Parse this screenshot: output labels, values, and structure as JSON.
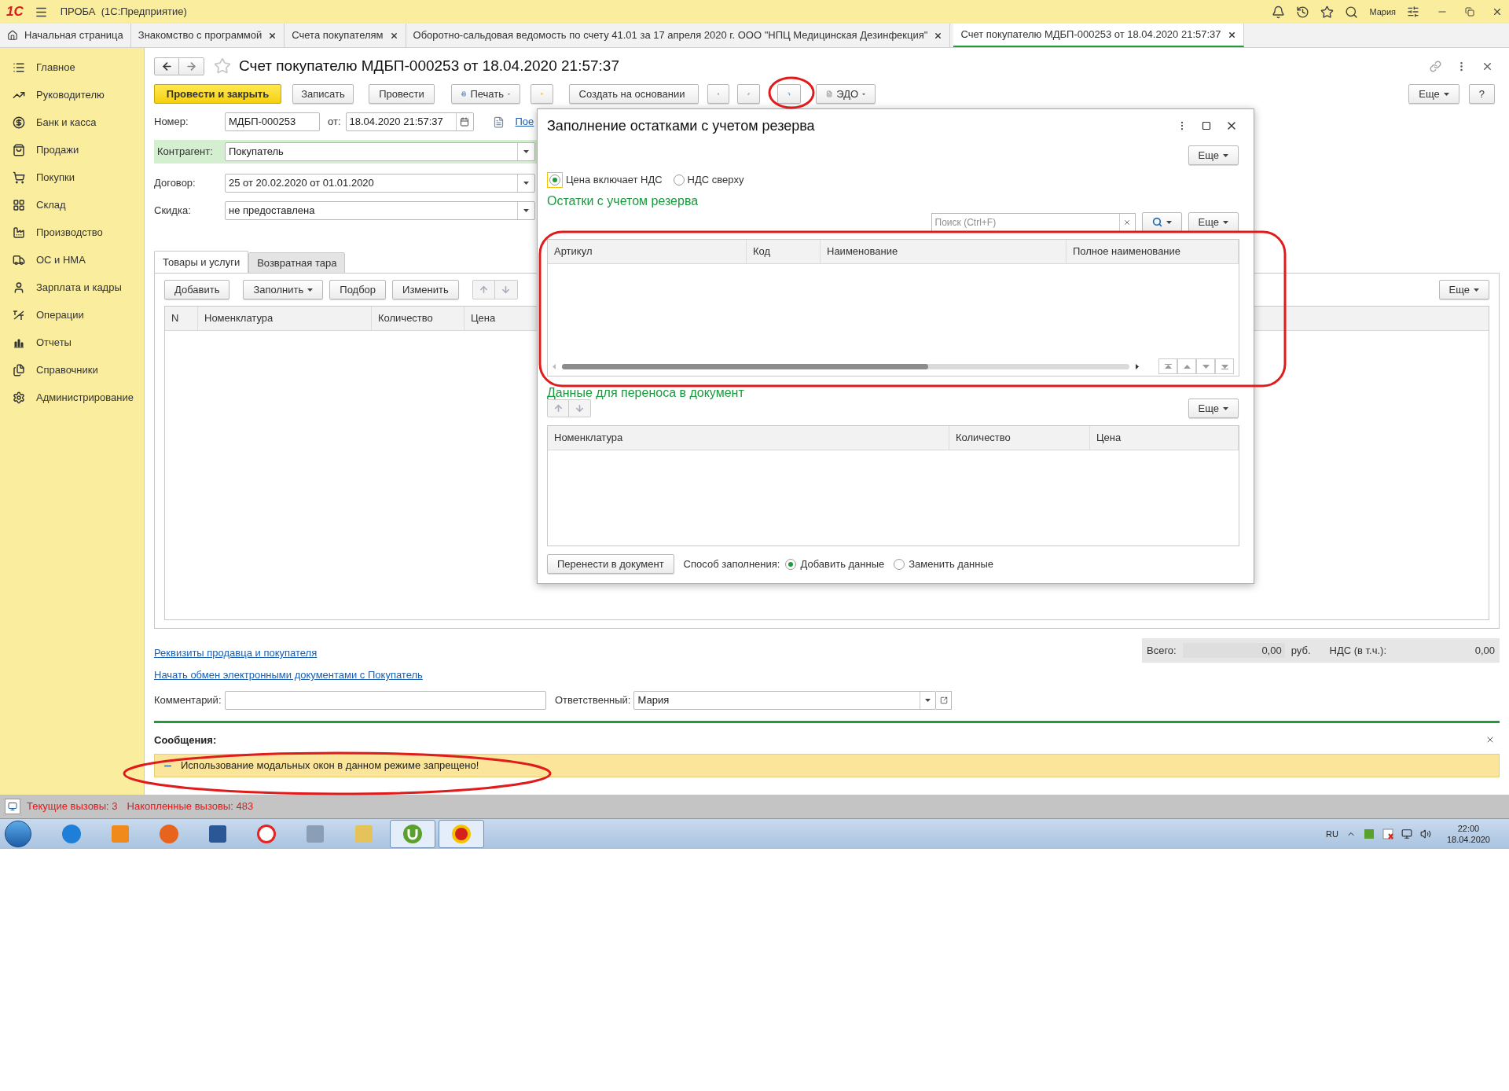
{
  "title_bar": {
    "logo": "1С",
    "app_title": "ПРОБА  (1С:Предприятие)",
    "user": "Мария"
  },
  "tabs": [
    {
      "label": "Начальная страница",
      "kind": "home",
      "selected": false
    },
    {
      "label": "Знакомство с программой",
      "kind": "page",
      "selected": false
    },
    {
      "label": "Счета покупателям",
      "kind": "page",
      "selected": false
    },
    {
      "label": "Оборотно-сальдовая ведомость по счету 41.01 за 17 апреля 2020 г. ООО \"НПЦ Медицинская Дезинфекция\"",
      "kind": "page",
      "selected": false
    },
    {
      "label": "Счет покупателю МДБП-000253 от 18.04.2020 21:57:37",
      "kind": "page",
      "selected": true
    }
  ],
  "sidebar": {
    "items": [
      {
        "label": "Главное",
        "kind": "menu"
      },
      {
        "label": "Руководителю",
        "kind": "trend"
      },
      {
        "label": "Банк и касса",
        "kind": "ruble"
      },
      {
        "label": "Продажи",
        "kind": "bag"
      },
      {
        "label": "Покупки",
        "kind": "cart"
      },
      {
        "label": "Склад",
        "kind": "grid"
      },
      {
        "label": "Производство",
        "kind": "factory"
      },
      {
        "label": "ОС и НМА",
        "kind": "truck"
      },
      {
        "label": "Зарплата и кадры",
        "kind": "user"
      },
      {
        "label": "Операции",
        "kind": "ledger"
      },
      {
        "label": "Отчеты",
        "kind": "chart"
      },
      {
        "label": "Справочники",
        "kind": "books"
      },
      {
        "label": "Администрирование",
        "kind": "gear"
      }
    ]
  },
  "document": {
    "title": "Счет покупателю МДБП-000253 от 18.04.2020 21:57:37",
    "favorite": false,
    "toolbar": [
      {
        "label": "Провести и закрыть",
        "kind": "primary"
      },
      {
        "label": "Записать",
        "kind": "button"
      },
      {
        "label": "Провести",
        "kind": "button"
      },
      {
        "label": "Печать",
        "kind": "menu"
      },
      {
        "kind": "icon"
      },
      {
        "label": "Создать на основании",
        "kind": "menu"
      },
      {
        "kind": "icon"
      },
      {
        "kind": "icon"
      },
      {
        "kind": "icon"
      },
      {
        "label": "ЭДО",
        "kind": "menu"
      }
    ],
    "more": "Еще",
    "help": "?",
    "number_label": "Номер:",
    "number": "МДБП-000253",
    "date_label": "от:",
    "date": "18.04.2020 21:57:37",
    "link_cut": "Пое",
    "fields": [
      {
        "label": "Контрагент:",
        "value": "Покупатель",
        "highlighted": true
      },
      {
        "label": "Договор:",
        "value": "25 от 20.02.2020 от 01.01.2020",
        "highlighted": false
      },
      {
        "label": "Скидка:",
        "value": "не предоставлена",
        "highlighted": false
      }
    ],
    "section_tabs": [
      {
        "label": "Товары и услуги",
        "selected": true
      },
      {
        "label": "Возвратная тара",
        "selected": false
      }
    ],
    "table_buttons": [
      {
        "label": "Добавить",
        "kind": "button"
      },
      {
        "label": "Заполнить",
        "kind": "menu"
      },
      {
        "label": "Подбор",
        "kind": "button"
      },
      {
        "label": "Изменить",
        "kind": "button"
      }
    ],
    "table_more": "Еще",
    "table": {
      "columns": [
        "N",
        "Номенклатура",
        "Количество",
        "Цена"
      ]
    },
    "links": [
      "Реквизиты продавца и покупателя",
      "Начать обмен электронными документами с Покупатель"
    ],
    "totals": {
      "total_label": "Всего:",
      "total": "0,00",
      "currency": "руб.",
      "vat_label": "НДС (в т.ч.):",
      "vat": "0,00"
    },
    "comment_label": "Комментарий:",
    "responsible_label": "Ответственный:",
    "responsible": "Мария"
  },
  "messages": {
    "title": "Сообщения:",
    "items": [
      "Использование модальных окон в данном режиме запрещено!"
    ]
  },
  "dialog": {
    "title": "Заполнение остатками с учетом резерва",
    "more": "Еще",
    "vat_options": [
      {
        "label": "Цена включает НДС",
        "selected": true
      },
      {
        "label": "НДС сверху",
        "selected": false
      }
    ],
    "stock_heading": "Остатки с учетом резерва",
    "search_placeholder": "Поиск (Ctrl+F)",
    "stock_more": "Еще",
    "stock_columns": [
      "Артикул",
      "Код",
      "Наименование",
      "Полное наименование"
    ],
    "transfer_heading": "Данные для переноса в документ",
    "transfer_more": "Еще",
    "transfer_columns": [
      "Номенклатура",
      "Количество",
      "Цена"
    ],
    "transfer_button": "Перенести в документ",
    "fill_label": "Способ заполнения:",
    "fill_options": [
      {
        "label": "Добавить данные",
        "selected": true
      },
      {
        "label": "Заменить данные",
        "selected": false
      }
    ]
  },
  "status_bar": {
    "current": "Текущие вызовы: 3",
    "accumulated": "Накопленные вызовы: 483"
  },
  "taskbar": {
    "apps": [
      {
        "kind": "browser",
        "active": false
      },
      {
        "kind": "media",
        "active": false
      },
      {
        "kind": "firefox",
        "active": false
      },
      {
        "kind": "word",
        "active": false
      },
      {
        "kind": "yandex",
        "active": false
      },
      {
        "kind": "calculator",
        "active": false
      },
      {
        "kind": "folder",
        "active": false
      },
      {
        "kind": "torrent",
        "active": true
      },
      {
        "kind": "onec",
        "active": true
      }
    ],
    "language": "RU",
    "time": "22:00",
    "date": "18.04.2020"
  }
}
